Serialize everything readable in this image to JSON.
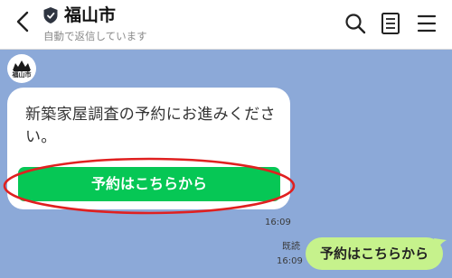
{
  "header": {
    "title": "福山市",
    "subtitle": "自動で返信しています"
  },
  "chat": {
    "avatar_text": "福山市",
    "message": {
      "text": "新築家屋調査の予約にお進みください。",
      "button_label": "予約はこちらから",
      "time": "16:09"
    },
    "sent": {
      "text": "予約はこちらから",
      "read_label": "既読",
      "time": "16:09"
    }
  },
  "colors": {
    "chat_background": "#8ca9d8",
    "button_green": "#06c755",
    "sent_bubble": "#c6f28c",
    "highlight": "#e02020"
  },
  "icons": [
    "back-icon",
    "shield-icon",
    "search-icon",
    "notes-icon",
    "menu-icon"
  ]
}
